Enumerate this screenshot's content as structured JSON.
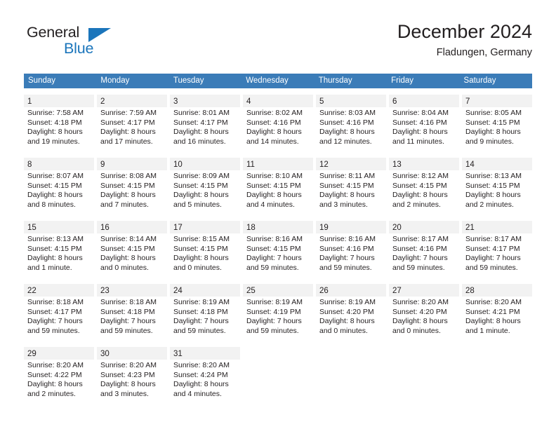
{
  "logo": {
    "word_one": "General",
    "word_two": "Blue",
    "triangle_icon": "blue-triangle-icon",
    "accent_color": "#1b75bb"
  },
  "header": {
    "title": "December 2024",
    "subtitle": "Fladungen, Germany"
  },
  "theme": {
    "header_blue": "#3b7cb8",
    "daynum_bg": "#f2f2f2",
    "text": "#231f20"
  },
  "calendar": {
    "weekdays": [
      "Sunday",
      "Monday",
      "Tuesday",
      "Wednesday",
      "Thursday",
      "Friday",
      "Saturday"
    ],
    "weeks": [
      [
        {
          "day": "1",
          "lines": [
            "Sunrise: 7:58 AM",
            "Sunset: 4:18 PM",
            "Daylight: 8 hours",
            "and 19 minutes."
          ]
        },
        {
          "day": "2",
          "lines": [
            "Sunrise: 7:59 AM",
            "Sunset: 4:17 PM",
            "Daylight: 8 hours",
            "and 17 minutes."
          ]
        },
        {
          "day": "3",
          "lines": [
            "Sunrise: 8:01 AM",
            "Sunset: 4:17 PM",
            "Daylight: 8 hours",
            "and 16 minutes."
          ]
        },
        {
          "day": "4",
          "lines": [
            "Sunrise: 8:02 AM",
            "Sunset: 4:16 PM",
            "Daylight: 8 hours",
            "and 14 minutes."
          ]
        },
        {
          "day": "5",
          "lines": [
            "Sunrise: 8:03 AM",
            "Sunset: 4:16 PM",
            "Daylight: 8 hours",
            "and 12 minutes."
          ]
        },
        {
          "day": "6",
          "lines": [
            "Sunrise: 8:04 AM",
            "Sunset: 4:16 PM",
            "Daylight: 8 hours",
            "and 11 minutes."
          ]
        },
        {
          "day": "7",
          "lines": [
            "Sunrise: 8:05 AM",
            "Sunset: 4:15 PM",
            "Daylight: 8 hours",
            "and 9 minutes."
          ]
        }
      ],
      [
        {
          "day": "8",
          "lines": [
            "Sunrise: 8:07 AM",
            "Sunset: 4:15 PM",
            "Daylight: 8 hours",
            "and 8 minutes."
          ]
        },
        {
          "day": "9",
          "lines": [
            "Sunrise: 8:08 AM",
            "Sunset: 4:15 PM",
            "Daylight: 8 hours",
            "and 7 minutes."
          ]
        },
        {
          "day": "10",
          "lines": [
            "Sunrise: 8:09 AM",
            "Sunset: 4:15 PM",
            "Daylight: 8 hours",
            "and 5 minutes."
          ]
        },
        {
          "day": "11",
          "lines": [
            "Sunrise: 8:10 AM",
            "Sunset: 4:15 PM",
            "Daylight: 8 hours",
            "and 4 minutes."
          ]
        },
        {
          "day": "12",
          "lines": [
            "Sunrise: 8:11 AM",
            "Sunset: 4:15 PM",
            "Daylight: 8 hours",
            "and 3 minutes."
          ]
        },
        {
          "day": "13",
          "lines": [
            "Sunrise: 8:12 AM",
            "Sunset: 4:15 PM",
            "Daylight: 8 hours",
            "and 2 minutes."
          ]
        },
        {
          "day": "14",
          "lines": [
            "Sunrise: 8:13 AM",
            "Sunset: 4:15 PM",
            "Daylight: 8 hours",
            "and 2 minutes."
          ]
        }
      ],
      [
        {
          "day": "15",
          "lines": [
            "Sunrise: 8:13 AM",
            "Sunset: 4:15 PM",
            "Daylight: 8 hours",
            "and 1 minute."
          ]
        },
        {
          "day": "16",
          "lines": [
            "Sunrise: 8:14 AM",
            "Sunset: 4:15 PM",
            "Daylight: 8 hours",
            "and 0 minutes."
          ]
        },
        {
          "day": "17",
          "lines": [
            "Sunrise: 8:15 AM",
            "Sunset: 4:15 PM",
            "Daylight: 8 hours",
            "and 0 minutes."
          ]
        },
        {
          "day": "18",
          "lines": [
            "Sunrise: 8:16 AM",
            "Sunset: 4:15 PM",
            "Daylight: 7 hours",
            "and 59 minutes."
          ]
        },
        {
          "day": "19",
          "lines": [
            "Sunrise: 8:16 AM",
            "Sunset: 4:16 PM",
            "Daylight: 7 hours",
            "and 59 minutes."
          ]
        },
        {
          "day": "20",
          "lines": [
            "Sunrise: 8:17 AM",
            "Sunset: 4:16 PM",
            "Daylight: 7 hours",
            "and 59 minutes."
          ]
        },
        {
          "day": "21",
          "lines": [
            "Sunrise: 8:17 AM",
            "Sunset: 4:17 PM",
            "Daylight: 7 hours",
            "and 59 minutes."
          ]
        }
      ],
      [
        {
          "day": "22",
          "lines": [
            "Sunrise: 8:18 AM",
            "Sunset: 4:17 PM",
            "Daylight: 7 hours",
            "and 59 minutes."
          ]
        },
        {
          "day": "23",
          "lines": [
            "Sunrise: 8:18 AM",
            "Sunset: 4:18 PM",
            "Daylight: 7 hours",
            "and 59 minutes."
          ]
        },
        {
          "day": "24",
          "lines": [
            "Sunrise: 8:19 AM",
            "Sunset: 4:18 PM",
            "Daylight: 7 hours",
            "and 59 minutes."
          ]
        },
        {
          "day": "25",
          "lines": [
            "Sunrise: 8:19 AM",
            "Sunset: 4:19 PM",
            "Daylight: 7 hours",
            "and 59 minutes."
          ]
        },
        {
          "day": "26",
          "lines": [
            "Sunrise: 8:19 AM",
            "Sunset: 4:20 PM",
            "Daylight: 8 hours",
            "and 0 minutes."
          ]
        },
        {
          "day": "27",
          "lines": [
            "Sunrise: 8:20 AM",
            "Sunset: 4:20 PM",
            "Daylight: 8 hours",
            "and 0 minutes."
          ]
        },
        {
          "day": "28",
          "lines": [
            "Sunrise: 8:20 AM",
            "Sunset: 4:21 PM",
            "Daylight: 8 hours",
            "and 1 minute."
          ]
        }
      ],
      [
        {
          "day": "29",
          "lines": [
            "Sunrise: 8:20 AM",
            "Sunset: 4:22 PM",
            "Daylight: 8 hours",
            "and 2 minutes."
          ]
        },
        {
          "day": "30",
          "lines": [
            "Sunrise: 8:20 AM",
            "Sunset: 4:23 PM",
            "Daylight: 8 hours",
            "and 3 minutes."
          ]
        },
        {
          "day": "31",
          "lines": [
            "Sunrise: 8:20 AM",
            "Sunset: 4:24 PM",
            "Daylight: 8 hours",
            "and 4 minutes."
          ]
        },
        {
          "day": "",
          "lines": []
        },
        {
          "day": "",
          "lines": []
        },
        {
          "day": "",
          "lines": []
        },
        {
          "day": "",
          "lines": []
        }
      ]
    ]
  }
}
